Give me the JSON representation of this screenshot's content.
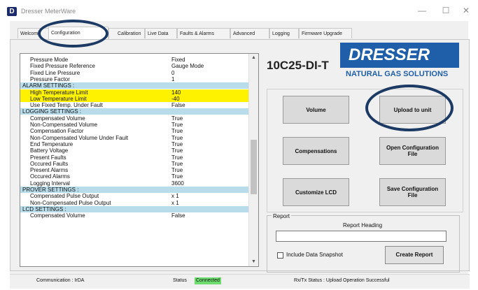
{
  "window": {
    "title": "Dresser MeterWare",
    "minimize": "—",
    "maximize": "☐",
    "close": "✕"
  },
  "tabs": [
    "Welcome",
    "Configuration",
    "Calibration",
    "Live Data",
    "Faults & Alarms",
    "Advanced",
    "Logging",
    "Firmware Upgrade"
  ],
  "active_tab": "Configuration",
  "properties": {
    "rows": [
      {
        "name": "Pressure Mode",
        "value": "Fixed"
      },
      {
        "name": "Fixed Pressure Reference",
        "value": "Gauge Mode"
      },
      {
        "name": "Fixed Line Pressure",
        "value": "0"
      },
      {
        "name": "Pressure Factor",
        "value": "1"
      },
      {
        "name": "ALARM SETTINGS :",
        "category": true
      },
      {
        "name": "High Temperature Limit",
        "value": "140",
        "highlight": true
      },
      {
        "name": "Low Temperature Limit",
        "value": "-40",
        "highlight": true
      },
      {
        "name": "Use Fixed Temp. Under Fault",
        "value": "False"
      },
      {
        "name": "LOGGING SETTINGS :",
        "category": true
      },
      {
        "name": "Compensated Volume",
        "value": "True"
      },
      {
        "name": "Non-Compensated Volume",
        "value": "True"
      },
      {
        "name": "Compensation Factor",
        "value": "True"
      },
      {
        "name": "Non-Compensated Volume Under Fault",
        "value": "True"
      },
      {
        "name": "End Temperature",
        "value": "True"
      },
      {
        "name": "Battery Voltage",
        "value": "True"
      },
      {
        "name": "Present Faults",
        "value": "True"
      },
      {
        "name": "Occured Faults",
        "value": "True"
      },
      {
        "name": "Present Alarms",
        "value": "True"
      },
      {
        "name": "Occured Alarms",
        "value": "True"
      },
      {
        "name": "Logging Interval",
        "value": "3600"
      },
      {
        "name": "PROVER SETTINGS :",
        "category": true
      },
      {
        "name": "Compensated Pulse Output",
        "value": "x 1"
      },
      {
        "name": "Non-Compensated Pulse Output",
        "value": "x 1"
      },
      {
        "name": "LCD SETTINGS :",
        "category": true
      },
      {
        "name": "Compensated Volume",
        "value": "False"
      }
    ],
    "scroll_up": "▲",
    "scroll_down": "▼"
  },
  "device": {
    "model": "10C25-DI-T"
  },
  "logo": {
    "word": "DRESSER",
    "subtitle": "NATURAL GAS SOLUTIONS"
  },
  "buttons": {
    "volume": "Volume",
    "upload": "Upload to unit",
    "compensations": "Compensations",
    "open_config": "Open Configuration\nFile",
    "customize_lcd": "Customize LCD",
    "save_config": "Save Configuration\nFile"
  },
  "report": {
    "group_label": "Report",
    "heading_label": "Report Heading",
    "heading_value": "",
    "include_snapshot": "Include Data Snapshot",
    "create_button": "Create Report"
  },
  "statusbar": {
    "communication": "Communication : IrDA",
    "status_label": "Status",
    "status_value": "Connected",
    "rx_tx": "Rx/Tx Status : Upload Operation Successful"
  },
  "colors": {
    "category_row": "#b8dcea",
    "highlight_row": "#fff200",
    "status_ok": "#6fdc6f",
    "annotation": "#1c3a64",
    "brand": "#1f5ea8"
  }
}
